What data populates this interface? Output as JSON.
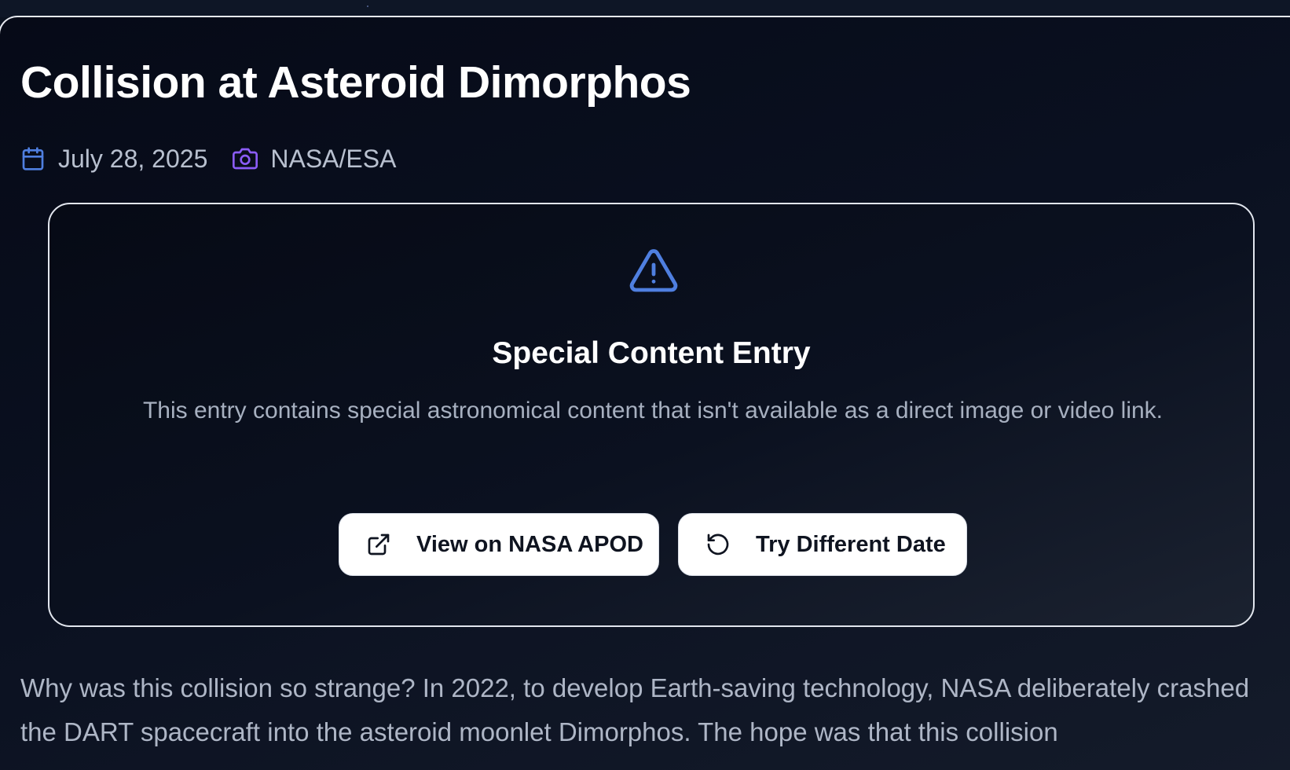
{
  "article": {
    "title": "Collision at Asteroid Dimorphos",
    "date": "July 28, 2025",
    "credit": "NASA/ESA"
  },
  "notice": {
    "icon": "alert-triangle-icon",
    "title": "Special Content Entry",
    "description": "This entry contains special astronomical content that isn't available as a direct image or video link.",
    "view_button_label": "View on NASA APOD",
    "retry_button_label": "Try Different Date"
  },
  "explanation": {
    "text": "Why was this collision so strange? In 2022, to develop Earth-saving technology, NASA deliberately crashed the DART spacecraft into the asteroid moonlet Dimorphos. The hope was that this collision"
  },
  "colors": {
    "accent_blue": "#4f7fe0",
    "accent_purple": "#8b5cf6",
    "title_white": "#ffffff",
    "muted_text": "#a7b0c0"
  }
}
